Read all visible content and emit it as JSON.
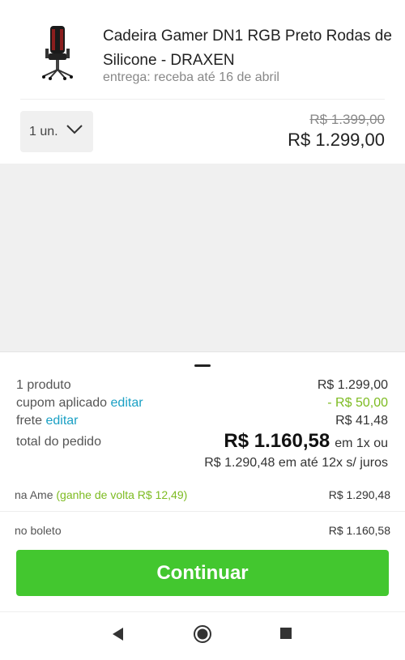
{
  "product": {
    "name": "Cadeira Gamer DN1 RGB Preto Rodas de Silicone - DRAXEN",
    "delivery": "entrega: receba até 16 de abril",
    "quantity_label": "1 un.",
    "old_price": "R$ 1.399,00",
    "price": "R$ 1.299,00"
  },
  "summary": {
    "products_label": "1 produto",
    "products_value": "R$ 1.299,00",
    "coupon_label": "cupom aplicado",
    "coupon_edit": "editar",
    "coupon_value": "- R$ 50,00",
    "shipping_label": "frete",
    "shipping_edit": "editar",
    "shipping_value": "R$ 41,48",
    "total_label": "total do pedido",
    "total_value": "R$ 1.160,58",
    "total_suffix": "em 1x ou",
    "installments": "R$ 1.290,48 em até 12x s/ juros"
  },
  "payments": {
    "ame_label": "na Ame",
    "ame_cashback": "(ganhe de volta R$ 12,49)",
    "ame_value": "R$ 1.290,48",
    "boleto_label": "no boleto",
    "boleto_value": "R$ 1.160,58"
  },
  "actions": {
    "continue_label": "Continuar"
  },
  "icons": {
    "quantity": "chevron-down-icon",
    "back": "back-triangle-icon",
    "home": "home-circle-icon",
    "recents": "recents-square-icon"
  },
  "colors": {
    "accent_green": "#43c72f",
    "link_blue": "#1aa0c4",
    "discount_green": "#7dbb21"
  }
}
